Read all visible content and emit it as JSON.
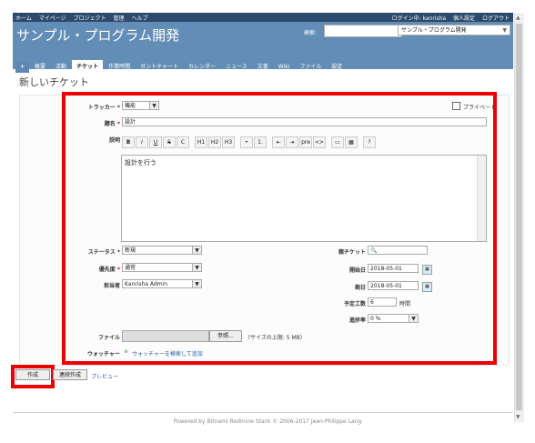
{
  "topnav": {
    "left": [
      "ホーム",
      "マイページ",
      "プロジェクト",
      "管理",
      "ヘルプ"
    ],
    "login_text": "ログイン中: kanrisha",
    "my_account": "個人設定",
    "logout": "ログアウト"
  },
  "header": {
    "title": "サンプル・プログラム開発",
    "search_label": "検索:",
    "search_placeholder": "",
    "project_select": "サンプル・プログラム開発"
  },
  "tabs": [
    "+",
    "概要",
    "活動",
    "チケット",
    "作業時間",
    "ガントチャート",
    "カレンダー",
    "ニュース",
    "文書",
    "Wiki",
    "ファイル",
    "設定"
  ],
  "page_title": "新しいチケット",
  "form": {
    "tracker_label": "トラッカー",
    "tracker_value": "機能",
    "private_label": "プライベート",
    "subject_label": "題名",
    "subject_value": "設計",
    "description_label": "説明",
    "toolbar": [
      "B",
      "I",
      "U",
      "S",
      "C",
      "H1",
      "H2",
      "H3",
      "•",
      "1.",
      "⇤",
      "⇥",
      "pre",
      "<>",
      "▭",
      "▦",
      "?"
    ],
    "description_value": "設計を行う",
    "status_label": "ステータス",
    "status_value": "新規",
    "priority_label": "優先度",
    "priority_value": "通常",
    "assignee_label": "担当者",
    "assignee_value": "Kanrisha Admin",
    "parent_label": "親チケット",
    "start_label": "開始日",
    "start_value": "2018-05-01",
    "due_label": "期日",
    "due_value": "2018-05-01",
    "estimated_label": "予定工数",
    "estimated_value": "6",
    "hours_unit": "時間",
    "done_label": "進捗率",
    "done_value": "0 %",
    "file_label": "ファイル",
    "browse_label": "参照...",
    "max_size": "（サイズの上限: 5 MB）",
    "watchers_label": "ウォッチャー",
    "watchers_link": "ウォッチャーを検索して追加"
  },
  "buttons": {
    "create": "作成",
    "create_continue": "連続作成",
    "preview": "プレビュー"
  },
  "footer": "Powered by Bitnami Redmine Stack © 2006-2017 Jean-Philippe Lang",
  "colors": {
    "header": "#628db6",
    "topbar": "#2c4a6b",
    "highlight": "#ee0000"
  }
}
